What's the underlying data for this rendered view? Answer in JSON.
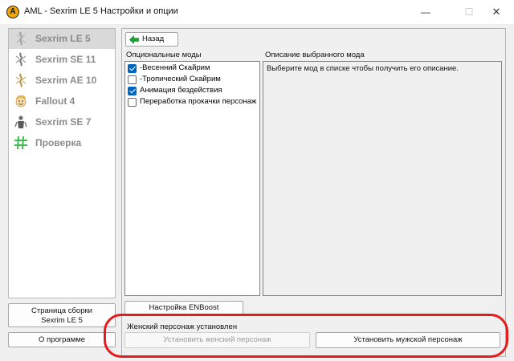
{
  "window": {
    "icon_letter": "A",
    "title": "AML - Sexrim LE 5 Настройки и опции",
    "minimize_glyph": "—",
    "maximize_glyph": "☐",
    "close_glyph": "✕"
  },
  "sidebar": {
    "games": [
      {
        "label": "Sexrim LE 5",
        "icon": "skyrim-emblem-icon",
        "selected": true
      },
      {
        "label": "Sexrim SE 11",
        "icon": "skyrim-emblem-icon",
        "selected": false
      },
      {
        "label": "Sexrim AE 10",
        "icon": "skyrim-gold-emblem-icon",
        "selected": false
      },
      {
        "label": "Fallout 4",
        "icon": "vault-boy-icon",
        "selected": false
      },
      {
        "label": "Sexrim SE 7",
        "icon": "warrior-icon",
        "selected": false
      },
      {
        "label": "Проверка",
        "icon": "hash-icon",
        "selected": false
      }
    ],
    "build_page_line1": "Страница сборки",
    "build_page_line2": "Sexrim LE 5",
    "about_label": "О программе"
  },
  "main": {
    "back_label": "Назад",
    "optional_mods_label": "Опциональные моды",
    "description_label": "Описание выбранного мода",
    "description_text": "Выберите мод в списке чтобы получить его описание.",
    "mods": [
      {
        "label": "-Весенний Скайрим",
        "checked": true
      },
      {
        "label": "-Тропический Скайрим",
        "checked": false
      },
      {
        "label": "Анимация бездействия",
        "checked": true
      },
      {
        "label": "Переработка прокачки персонаж",
        "checked": false
      }
    ],
    "enboost_label": "Настройка ENBoost",
    "status_text": "Женский персонаж установлен",
    "install_female_label": "Установить женский персонаж",
    "install_male_label": "Установить мужской персонаж"
  },
  "colors": {
    "accent": "#0067c0",
    "highlight_ring": "#e31d1d",
    "back_arrow": "#1aa332"
  }
}
